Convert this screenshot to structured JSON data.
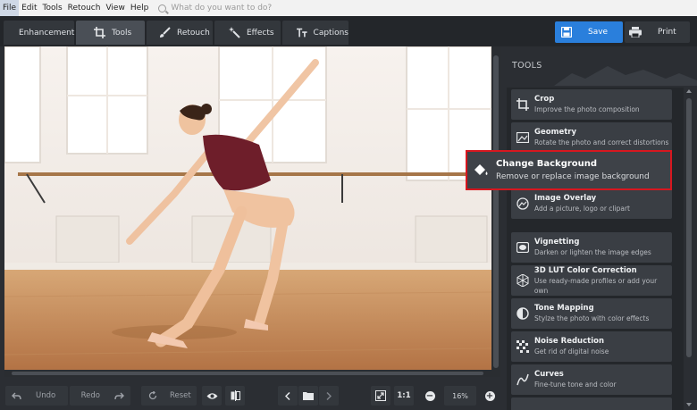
{
  "menubar": {
    "items": [
      "File",
      "Edit",
      "Tools",
      "Retouch",
      "View",
      "Help"
    ],
    "search_placeholder": "What do you want to do?"
  },
  "toolbar": {
    "tabs": [
      {
        "label": "Enhancement",
        "icon": "sliders-icon"
      },
      {
        "label": "Tools",
        "icon": "crop-icon",
        "active": true
      },
      {
        "label": "Retouch",
        "icon": "brush-icon"
      },
      {
        "label": "Effects",
        "icon": "magic-wand-icon"
      },
      {
        "label": "Captions",
        "icon": "text-icon"
      }
    ],
    "save_label": "Save",
    "print_label": "Print"
  },
  "sidebar": {
    "title": "TOOLS",
    "tools": [
      {
        "name": "Crop",
        "desc": "Improve the photo composition",
        "icon": "crop-icon"
      },
      {
        "name": "Geometry",
        "desc": "Rotate the photo and correct distortions",
        "icon": "geometry-icon"
      },
      {
        "name": "Change Background",
        "desc": "Remove or replace image background",
        "icon": "paint-bucket-icon",
        "highlighted": true
      },
      {
        "name": "Image Overlay",
        "desc": "Add a picture, logo or clipart",
        "icon": "overlay-icon"
      },
      {
        "name": "Vignetting",
        "desc": "Darken or lighten the image edges",
        "icon": "vignette-icon"
      },
      {
        "name": "3D LUT Color Correction",
        "desc": "Use ready-made profiles or add your own",
        "icon": "lut-cube-icon"
      },
      {
        "name": "Tone Mapping",
        "desc": "Stylze the photo with color effects",
        "icon": "tone-mapping-icon"
      },
      {
        "name": "Noise Reduction",
        "desc": "Get rid of digital noise",
        "icon": "noise-icon"
      },
      {
        "name": "Curves",
        "desc": "Fine-tune tone and color",
        "icon": "curves-icon"
      }
    ]
  },
  "bottombar": {
    "undo_label": "Undo",
    "redo_label": "Redo",
    "reset_label": "Reset",
    "ratio_label": "1:1",
    "zoom_value": "16%"
  },
  "colors": {
    "accent": "#2a7fdc",
    "highlight_border": "#d7171f",
    "background": "#2b2e33"
  }
}
